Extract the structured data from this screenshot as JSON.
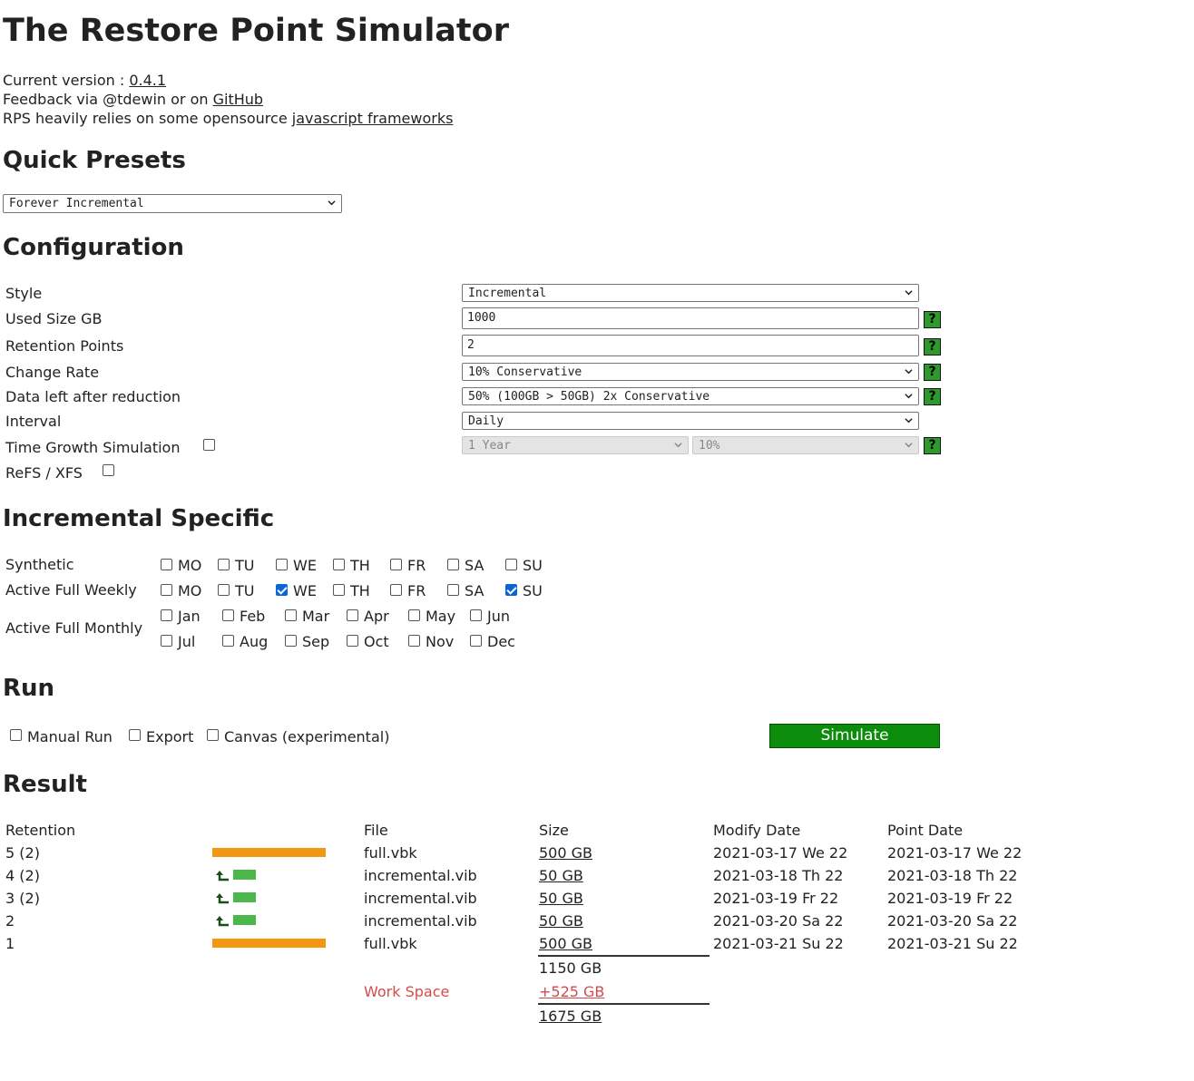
{
  "title": "The Restore Point Simulator",
  "info": {
    "version_prefix": "Current version : ",
    "version": "0.4.1",
    "feedback_prefix": "Feedback via @tdewin or on ",
    "feedback_link": "GitHub",
    "relies_prefix": "RPS heavily relies on some opensource ",
    "relies_link": "javascript frameworks"
  },
  "presets": {
    "heading": "Quick Presets",
    "selected": "Forever Incremental"
  },
  "configuration": {
    "heading": "Configuration",
    "style": {
      "label": "Style",
      "value": "Incremental"
    },
    "used_size": {
      "label": "Used Size GB",
      "value": "1000"
    },
    "retention_points": {
      "label": "Retention Points",
      "value": "2"
    },
    "change_rate": {
      "label": "Change Rate",
      "value": "10% Conservative"
    },
    "data_left": {
      "label": "Data left after reduction",
      "value": "50% (100GB > 50GB) 2x Conservative"
    },
    "interval": {
      "label": "Interval",
      "value": "Daily"
    },
    "time_growth": {
      "label": "Time Growth Simulation",
      "checked": false,
      "period": "1 Year",
      "rate": "10%"
    },
    "refs": {
      "label": "ReFS / XFS",
      "checked": false
    },
    "help_glyph": "?"
  },
  "incremental": {
    "heading": "Incremental Specific",
    "synthetic_label": "Synthetic",
    "active_weekly_label": "Active Full Weekly",
    "active_monthly_label": "Active Full Monthly",
    "days": [
      "MO",
      "TU",
      "WE",
      "TH",
      "FR",
      "SA",
      "SU"
    ],
    "synthetic_checked": [
      false,
      false,
      false,
      false,
      false,
      false,
      false
    ],
    "weekly_checked": [
      false,
      false,
      true,
      false,
      false,
      false,
      true
    ],
    "months_row1": [
      "Jan",
      "Feb",
      "Mar",
      "Apr",
      "May",
      "Jun"
    ],
    "months_row2": [
      "Jul",
      "Aug",
      "Sep",
      "Oct",
      "Nov",
      "Dec"
    ]
  },
  "run": {
    "heading": "Run",
    "manual_run": "Manual Run",
    "export": "Export",
    "canvas": "Canvas (experimental)",
    "simulate_button": "Simulate"
  },
  "result": {
    "heading": "Result",
    "columns": {
      "retention": "Retention",
      "file": "File",
      "size": "Size",
      "modify": "Modify Date",
      "point": "Point Date"
    },
    "rows": [
      {
        "retention": "5 (2)",
        "kind": "full",
        "file": "full.vbk",
        "size": "500 GB",
        "modify": "2021-03-17 We 22",
        "point": "2021-03-17 We 22"
      },
      {
        "retention": "4 (2)",
        "kind": "inc",
        "file": "incremental.vib",
        "size": "50 GB",
        "modify": "2021-03-18 Th 22",
        "point": "2021-03-18 Th 22"
      },
      {
        "retention": "3 (2)",
        "kind": "inc",
        "file": "incremental.vib",
        "size": "50 GB",
        "modify": "2021-03-19 Fr 22",
        "point": "2021-03-19 Fr 22"
      },
      {
        "retention": "2",
        "kind": "inc",
        "file": "incremental.vib",
        "size": "50 GB",
        "modify": "2021-03-20 Sa 22",
        "point": "2021-03-20 Sa 22"
      },
      {
        "retention": "1",
        "kind": "full",
        "file": "full.vbk",
        "size": "500 GB",
        "modify": "2021-03-21 Su 22",
        "point": "2021-03-21 Su 22"
      }
    ],
    "subtotal": "1150 GB",
    "workspace_label": "Work Space",
    "workspace_value": "+525 GB",
    "total": "1675 GB"
  },
  "colors": {
    "full_bar": "#f29712",
    "inc_bar": "#4cb84c",
    "simulate": "#0b8c0b",
    "help": "#2e9a2e",
    "workspace": "#d44b4b"
  }
}
